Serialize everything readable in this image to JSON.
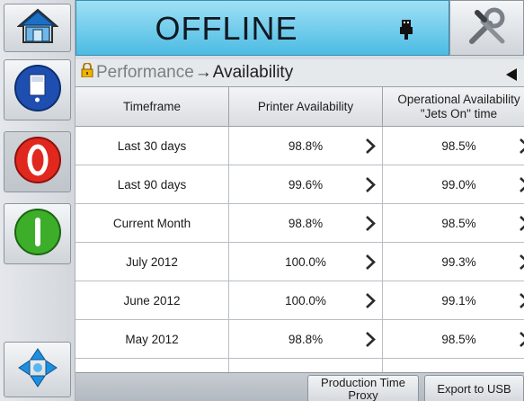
{
  "status": {
    "text": "OFFLINE"
  },
  "breadcrumb": {
    "parent": "Performance",
    "separator": "→",
    "current": "Availability"
  },
  "table": {
    "headers": [
      "Timeframe",
      "Printer Availability",
      "Operational Availability \"Jets On\" time"
    ],
    "rows": [
      {
        "timeframe": "Last 30 days",
        "printer": "98.8%",
        "operational": "98.5%"
      },
      {
        "timeframe": "Last 90 days",
        "printer": "99.6%",
        "operational": "99.0%"
      },
      {
        "timeframe": "Current Month",
        "printer": "98.8%",
        "operational": "98.5%"
      },
      {
        "timeframe": "July 2012",
        "printer": "100.0%",
        "operational": "99.3%"
      },
      {
        "timeframe": "June 2012",
        "printer": "100.0%",
        "operational": "99.1%"
      },
      {
        "timeframe": "May 2012",
        "printer": "98.8%",
        "operational": "98.5%"
      }
    ]
  },
  "bottom": {
    "production_time_proxy": "Production Time Proxy",
    "export_to_usb": "Export to USB"
  },
  "icons": {
    "home": "home-icon",
    "info": "info-icon",
    "stop": "stop-icon",
    "start": "start-icon",
    "navigate": "navigation-arrows-icon",
    "tools": "tools-icon",
    "usb": "usb-icon",
    "lock": "lock-icon",
    "back": "back-arrow-icon",
    "row_detail": "chevron-right-icon"
  },
  "colors": {
    "status_bar": "#4cbbe3",
    "stop": "#e0281e",
    "start": "#3cae2a",
    "info": "#1e4fb0"
  }
}
